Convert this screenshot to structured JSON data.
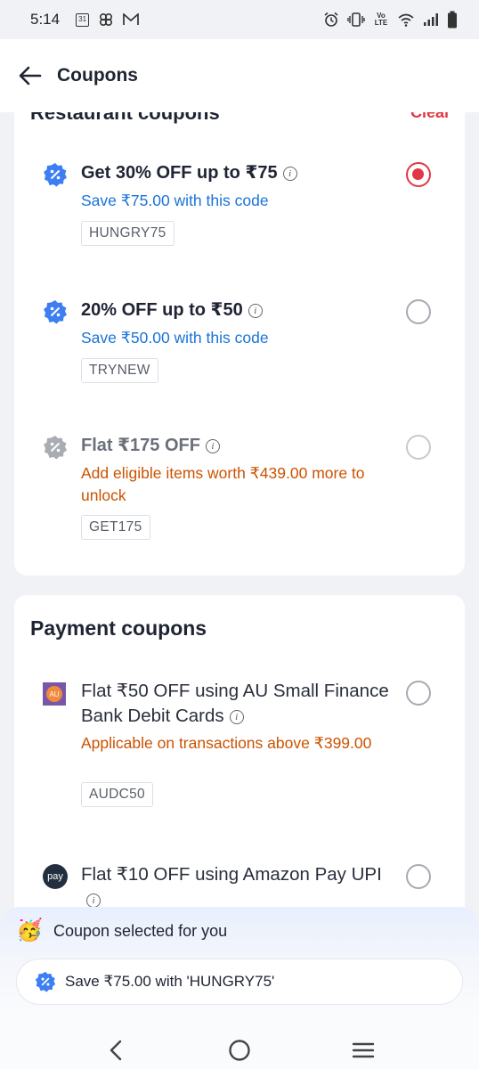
{
  "status_bar": {
    "time": "5:14",
    "left_icons": [
      "calendar-icon",
      "pinwheel-icon",
      "gmail-icon"
    ],
    "calendar_day": "31",
    "right_icons": [
      "alarm-icon",
      "vibrate-icon",
      "volte-icon",
      "wifi-icon",
      "signal-icon",
      "battery-icon"
    ],
    "volte_label": "Vo LTE"
  },
  "header": {
    "title": "Coupons"
  },
  "restaurant_section": {
    "title": "Restaurant coupons",
    "clear_label": "Clear",
    "coupons": [
      {
        "title": "Get 30% OFF up to ₹75",
        "subtitle": "Save ₹75.00 with this code",
        "code": "HUNGRY75",
        "selected": true,
        "eligible": true
      },
      {
        "title": "20% OFF up to ₹50",
        "subtitle": "Save ₹50.00 with this code",
        "code": "TRYNEW",
        "selected": false,
        "eligible": true
      },
      {
        "title": "Flat ₹175 OFF",
        "subtitle": "Add eligible items worth ₹439.00 more to unlock",
        "code": "GET175",
        "selected": false,
        "eligible": false
      }
    ]
  },
  "payment_section": {
    "title": "Payment coupons",
    "coupons": [
      {
        "title": "Flat ₹50 OFF using AU Small Finance Bank Debit Cards",
        "subtitle": "Applicable on transactions above ₹399.00",
        "code": "AUDC50",
        "logo_text": "AU",
        "selected": false
      },
      {
        "title": "Flat ₹10 OFF using Amazon Pay UPI",
        "logo_text": "pay",
        "selected": false
      }
    ]
  },
  "bottom_panel": {
    "selected_label": "Coupon selected for you",
    "selected_coupon_text": "Save ₹75.00 with 'HUNGRY75'"
  },
  "nav_bar": {
    "items": [
      "back-nav-icon",
      "home-nav-icon",
      "recents-nav-icon"
    ]
  },
  "colors": {
    "accent": "#e23744",
    "blue_text": "#1a73d9",
    "orange_text": "#cc5200",
    "coupon_badge": "#3d7ff2"
  }
}
